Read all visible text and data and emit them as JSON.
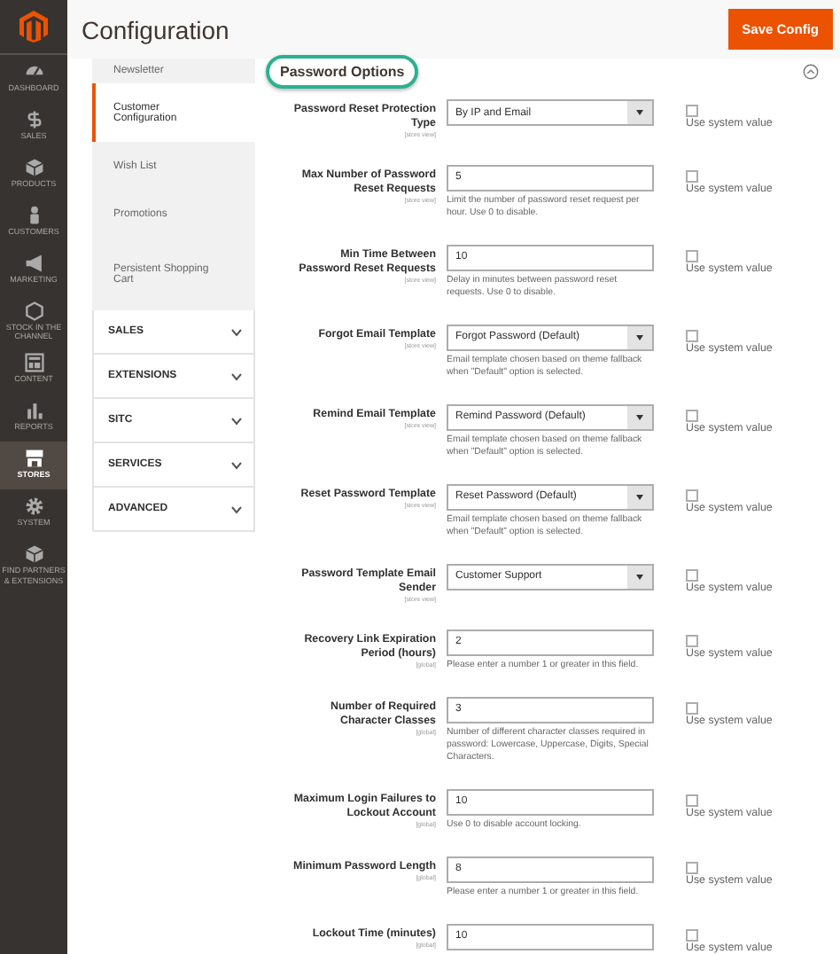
{
  "header": {
    "title": "Configuration",
    "save_button": "Save Config"
  },
  "nav": [
    {
      "label": "DASHBOARD",
      "kind": "gauge",
      "selected": false
    },
    {
      "label": "SALES",
      "kind": "dollar",
      "selected": false
    },
    {
      "label": "PRODUCTS",
      "kind": "box",
      "selected": false
    },
    {
      "label": "CUSTOMERS",
      "kind": "person",
      "selected": false
    },
    {
      "label": "MARKETING",
      "kind": "megaphone",
      "selected": false
    },
    {
      "label": "STOCK IN THE CHANNEL",
      "kind": "hexagon",
      "selected": false
    },
    {
      "label": "CONTENT",
      "kind": "layout",
      "selected": false
    },
    {
      "label": "REPORTS",
      "kind": "bars",
      "selected": false
    },
    {
      "label": "STORES",
      "kind": "store",
      "selected": true
    },
    {
      "label": "SYSTEM",
      "kind": "gear",
      "selected": false
    },
    {
      "label": "FIND PARTNERS & EXTENSIONS",
      "kind": "cube",
      "selected": false
    }
  ],
  "config_menu": {
    "items": [
      {
        "label": "Newsletter",
        "selected": false
      },
      {
        "label": "Customer Configuration",
        "selected": true
      },
      {
        "label": "Wish List",
        "selected": false
      },
      {
        "label": "Promotions",
        "selected": false
      },
      {
        "label": "Persistent Shopping Cart",
        "selected": false
      }
    ],
    "sections": [
      {
        "label": "SALES",
        "expanded": false
      },
      {
        "label": "EXTENSIONS",
        "expanded": false
      },
      {
        "label": "SITC",
        "expanded": false
      },
      {
        "label": "SERVICES",
        "expanded": false
      },
      {
        "label": "ADVANCED",
        "expanded": false
      }
    ]
  },
  "fieldset": {
    "title": "Password Options",
    "expanded": true,
    "rows": [
      {
        "kind": "select",
        "label": "Password Reset Protection Type",
        "scope": "[store view]",
        "value": "By IP and Email",
        "use_system_label": "Use system value",
        "use_system": false
      },
      {
        "kind": "input",
        "label": "Max Number of Password Reset Requests",
        "scope": "[store view]",
        "value": "5",
        "hint": "Limit the number of password reset request per hour. Use 0 to disable.",
        "use_system_label": "Use system value",
        "use_system": false
      },
      {
        "kind": "input",
        "label": "Min Time Between Password Reset Requests",
        "scope": "[store view]",
        "value": "10",
        "hint": "Delay in minutes between password reset requests. Use 0 to disable.",
        "use_system_label": "Use system value",
        "use_system": false
      },
      {
        "kind": "select",
        "label": "Forgot Email Template",
        "scope": "[store view]",
        "value": "Forgot Password (Default)",
        "hint": "Email template chosen based on theme fallback when \"Default\" option is selected.",
        "use_system_label": "Use system value",
        "use_system": false
      },
      {
        "kind": "select",
        "label": "Remind Email Template",
        "scope": "[store view]",
        "value": "Remind Password (Default)",
        "hint": "Email template chosen based on theme fallback when \"Default\" option is selected.",
        "use_system_label": "Use system value",
        "use_system": false
      },
      {
        "kind": "select",
        "label": "Reset Password Template",
        "scope": "[store view]",
        "value": "Reset Password (Default)",
        "hint": "Email template chosen based on theme fallback when \"Default\" option is selected.",
        "use_system_label": "Use system value",
        "use_system": false
      },
      {
        "kind": "select",
        "label": "Password Template Email Sender",
        "scope": "[store view]",
        "value": "Customer Support",
        "use_system_label": "Use system value",
        "use_system": false
      },
      {
        "kind": "input",
        "label": "Recovery Link Expiration Period (hours)",
        "scope": "[global]",
        "value": "2",
        "hint": "Please enter a number 1 or greater in this field.",
        "use_system_label": "Use system value",
        "use_system": false
      },
      {
        "kind": "input",
        "label": "Number of Required Character Classes",
        "scope": "[global]",
        "value": "3",
        "hint": "Number of different character classes required in password: Lowercase, Uppercase, Digits, Special Characters.",
        "use_system_label": "Use system value",
        "use_system": false
      },
      {
        "kind": "input",
        "label": "Maximum Login Failures to Lockout Account",
        "scope": "[global]",
        "value": "10",
        "hint": "Use 0 to disable account locking.",
        "use_system_label": "Use system value",
        "use_system": false
      },
      {
        "kind": "input",
        "label": "Minimum Password Length",
        "scope": "[global]",
        "value": "8",
        "hint": "Please enter a number 1 or greater in this field.",
        "use_system_label": "Use system value",
        "use_system": false
      },
      {
        "kind": "input",
        "label": "Lockout Time (minutes)",
        "scope": "[global]",
        "value": "10",
        "use_system_label": "Use system value",
        "use_system": false
      }
    ]
  }
}
